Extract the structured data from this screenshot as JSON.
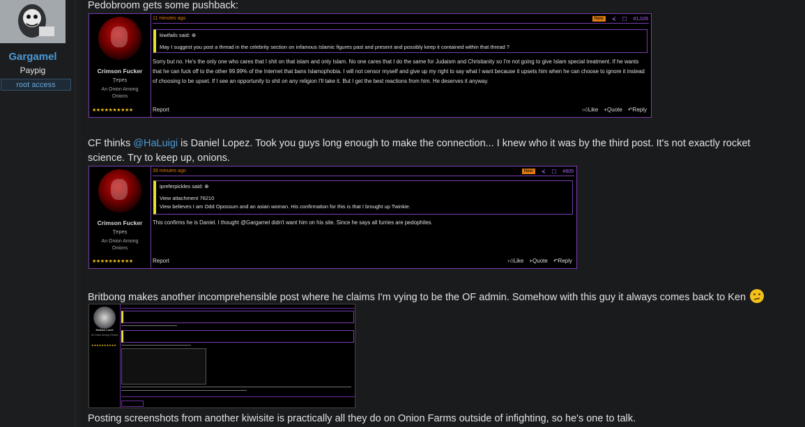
{
  "sidebar": {
    "username": "Gargamel",
    "user_title": "Paypig",
    "banner": "root access"
  },
  "posts": [
    {
      "text": "Pedobroom gets some pushback:",
      "embed": {
        "author": "Crimson Fucker",
        "rank": "Ţepeș",
        "title_line1": "An Onion Among",
        "title_line2": "Onions",
        "stars": "★★★★★★★★★★",
        "time": "11 minutes ago",
        "badge": "New",
        "post_number": "#1,026",
        "quote_header": "kiwifails said:",
        "quote_lines": [
          "May I suggest you post a thread in the celebrity section on infamous Islamic figures past and present and possibly keep it contained within that thread ?"
        ],
        "body": "Sorry but no. He's the only one who cares that I shit on that islam and only Islam. No one cares that I do the same for Judaism and Christianity so I'm not going to give Islam special treatment. If he wants that he can fuck off to the other 99.99% of the Internet that bans Islamophobia. I will not censor myself and give up my right to say what I want because it upsets him when he can choose to ignore it instead of choosing to be upset. If I see an opportunity to shit on any religion I'll take it. But I get the best reactions from him. He deserves it anyway.",
        "report": "Report",
        "actions": [
          "Like",
          "Quote",
          "Reply"
        ]
      }
    },
    {
      "text_before": "CF thinks ",
      "mention": "@HaLuigi",
      "text_after": " is Daniel Lopez. Took you guys long enough to make the connection... I knew who it was by the third post. It's not exactly rocket science. Try to keep up, onions.",
      "embed": {
        "author": "Crimson Fucker",
        "rank": "Ţepeș",
        "title_line1": "An Onion Among",
        "title_line2": "Onions",
        "stars": "★★★★★★★★★★",
        "time": "39 minutes ago",
        "badge": "New",
        "post_number": "#605",
        "quote_header": "ipreferpickles said:",
        "quote_lines": [
          "View attachment 76210",
          "View believes I am Odd Opossum and an asian woman. His confirmation for this is that I brought up Twinkie."
        ],
        "body": "This confirms he is Daniel. I thought @Gargamel didn't want him on his site. Since he says all furries are pedophiles.",
        "report": "Report",
        "actions": [
          "Like",
          "Quote",
          "Reply"
        ]
      }
    },
    {
      "text": "Britbong makes another incomprehensible post where he claims I'm vying to be the OF admin. Somehow with this guy it always comes back to Ken"
    },
    {
      "text": "Posting screenshots from another kiwisite is practically all they do on Onion Farms outside of infighting, so he's one to talk."
    }
  ],
  "screenshot": {
    "author": "Nathan Larrd",
    "title": "An Onion Among Onions",
    "stars": "★★★★★★★★★★"
  },
  "colors": {
    "accent": "#7a3fb0",
    "mention": "#4b9ad6",
    "new_badge": "#e07a10",
    "quote_bar": "#e8e02a"
  }
}
